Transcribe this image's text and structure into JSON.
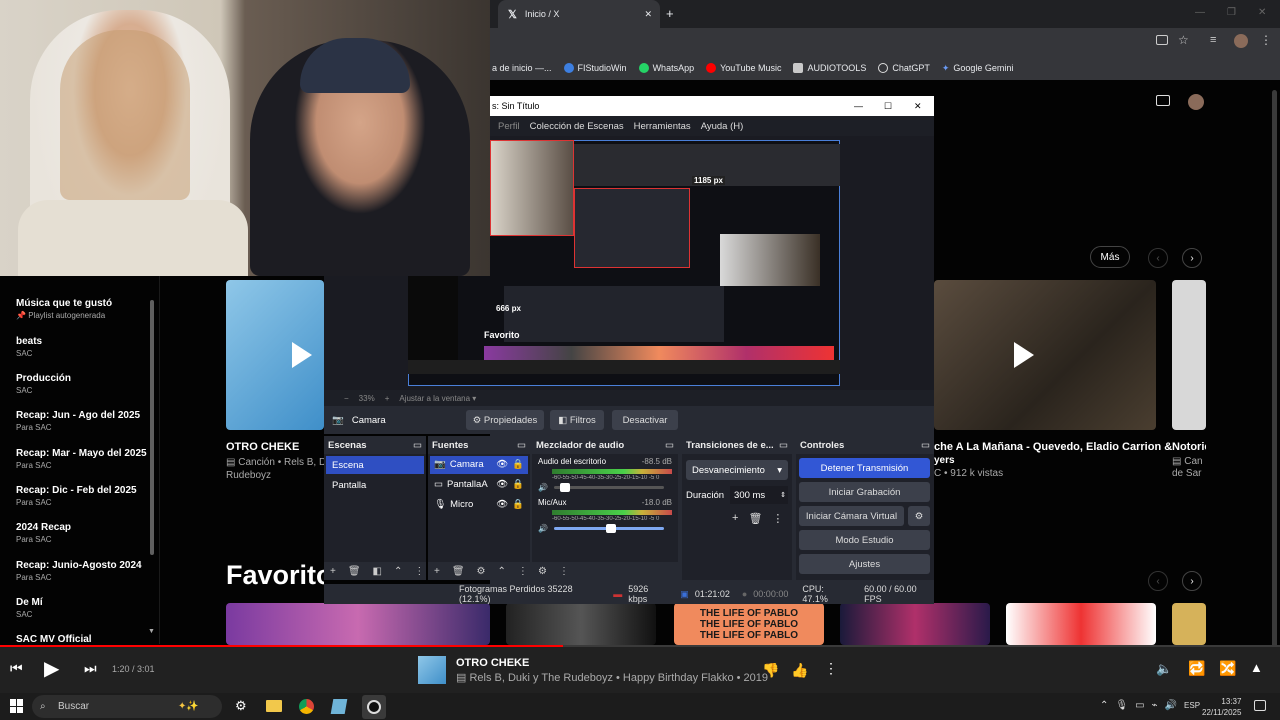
{
  "chrome": {
    "tab_title": "Inicio / X",
    "bookmarks": [
      "a de inicio —...",
      "FIStudioWin",
      "WhatsApp",
      "YouTube Music",
      "AUDIOTOOLS",
      "ChatGPT",
      "Google Gemini"
    ]
  },
  "sidebar": {
    "items": [
      {
        "title": "Música que te gustó",
        "sub": "Playlist autogenerada"
      },
      {
        "title": "beats",
        "sub": "SAC"
      },
      {
        "title": "Producción",
        "sub": "SAC"
      },
      {
        "title": "Recap: Jun - Ago del 2025",
        "sub": "Para SAC"
      },
      {
        "title": "Recap: Mar - Mayo del 2025",
        "sub": "Para SAC"
      },
      {
        "title": "Recap: Dic - Feb del 2025",
        "sub": "Para SAC"
      },
      {
        "title": "2024 Recap",
        "sub": "Para SAC"
      },
      {
        "title": "Recap: Junio-Agosto 2024",
        "sub": "Para SAC"
      },
      {
        "title": "De Mí",
        "sub": "SAC"
      },
      {
        "title": "SAC MV Official",
        "sub": ""
      }
    ]
  },
  "main": {
    "more_label": "Más",
    "card1_title": "OTRO CHEKE",
    "card1_sub": "Canción • Rels B, D",
    "card1_sub2": "Rudeboyz",
    "card3_title": "che A La Mañana - Quevedo, Eladio Carrion &",
    "card3_sub": "yers",
    "card3_views": "C • 912 k vistas",
    "card4_title": "Notoric",
    "card4_sub": "Can",
    "card4_sub2": "de Sar",
    "favorites_title": "Favorito",
    "album_text": "THE LIFE OF PABLO"
  },
  "obs": {
    "window_title": "s: Sin Título",
    "menu": [
      "Perfil",
      "Colección de Escenas",
      "Herramientas",
      "Ayuda (H)"
    ],
    "preview_px_top": "1185 px",
    "preview_px_left": "666 px",
    "preview_favorites": "Favorito",
    "zoom": "33%",
    "fit_label": "Ajustar a la ventana",
    "current_source": "Camara",
    "btn_props": "Propiedades",
    "btn_filters": "Filtros",
    "btn_disable": "Desactivar",
    "scenes_title": "Escenas",
    "scenes": [
      "Escena",
      "Pantalla"
    ],
    "sources_title": "Fuentes",
    "sources": [
      "Camara",
      "PantallaA",
      "Micro"
    ],
    "mixer_title": "Mezclador de audio",
    "mixer": [
      {
        "name": "Audio del escritorio",
        "db": "-88.5 dB",
        "scale": "-60-55-50-45-40-35-30-25-20-15-10 -5 0"
      },
      {
        "name": "Mic/Aux",
        "db": "-18.0 dB",
        "scale": "-60-55-50-45-40-35-30-25-20-15-10 -5 0"
      }
    ],
    "transitions_title": "Transiciones de e...",
    "transition_value": "Desvanecimiento",
    "duration_label": "Duración",
    "duration_value": "300 ms",
    "controls_title": "Controles",
    "controls": [
      "Detener Transmisión",
      "Iniciar Grabación",
      "Iniciar Cámara Virtual",
      "Modo Estudio",
      "Ajustes"
    ],
    "status": {
      "frames": "Fotogramas Perdidos 35228 (12.1%)",
      "bitrate": "5926 kbps",
      "live_time": "01:21:02",
      "rec_time": "00:00:00",
      "cpu": "CPU: 47.1%",
      "fps": "60.00 / 60.00 FPS"
    }
  },
  "player": {
    "time": "1:20 / 3:01",
    "progress": 0.44,
    "song_title": "OTRO CHEKE",
    "song_sub": "Rels B, Duki y The Rudeboyz • Happy Birthday Flakko • 2019"
  },
  "taskbar": {
    "search_placeholder": "Buscar",
    "lang": "ESP",
    "time": "13:37",
    "date": "22/11/2025"
  },
  "colors": {
    "accent_blue": "#3257d5",
    "yt_red": "#ff0000",
    "obs_bg": "#272a33"
  }
}
